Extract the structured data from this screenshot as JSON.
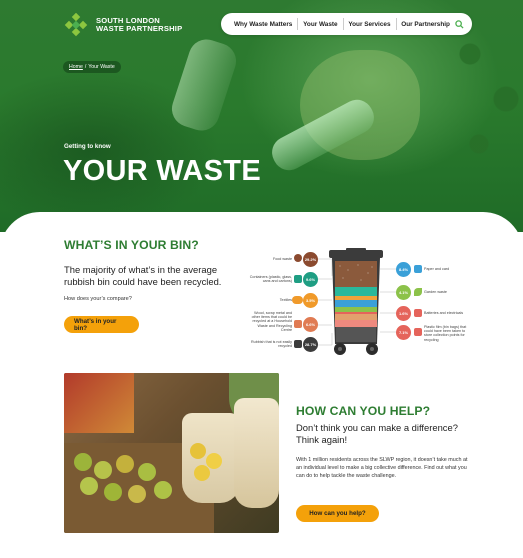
{
  "header": {
    "logo_line1": "SOUTH LONDON",
    "logo_line2": "WASTE PARTNERSHIP",
    "brand_color": "#2e7d32",
    "nav_items": [
      "Why Waste Matters",
      "Your Waste",
      "Your Services",
      "Our Partnership"
    ],
    "search_icon": "search-icon"
  },
  "breadcrumb": {
    "home": "Home",
    "separator": "/",
    "current": "Your Waste"
  },
  "hero": {
    "kicker": "Getting to know",
    "title": "YOUR WASTE"
  },
  "bin_section": {
    "title": "WHAT’S IN YOUR BIN?",
    "lead": "The majority of what’s in the average rubbish bin could have been recycled.",
    "question": "How does your’s compare?",
    "button": "What’s in your bin?",
    "accent": "#f4a10a",
    "infographic": {
      "left": [
        {
          "label": "Food waste",
          "pct": "29.2%",
          "color": "#8b4a2f"
        },
        {
          "label": "Containers (plastic, glass, cans and cartons)",
          "pct": "9.6%",
          "color": "#1f9e83"
        },
        {
          "label": "Textiles",
          "pct": "3.5%",
          "color": "#f09a2a"
        },
        {
          "label": "Wood, scrap metal and other items that could be recycled at a Household Waste and Recycling Centre",
          "pct": "6.6%",
          "color": "#e07b53"
        },
        {
          "label": "Rubbish that is not easily recycled",
          "pct": "28.7%",
          "color": "#3c3c3c"
        }
      ],
      "right": [
        {
          "label": "Paper and card",
          "pct": "8.4%",
          "color": "#3aa0d8"
        },
        {
          "label": "Garden waste",
          "pct": "4.1%",
          "color": "#8cc24a"
        },
        {
          "label": "Batteries and electricals",
          "pct": "1.6%",
          "color": "#e5645b"
        },
        {
          "label": "Plastic film (bin bags) that could have been taken to store collection points for recycling",
          "pct": "7.1%",
          "color": "#e5645b"
        }
      ]
    }
  },
  "help_section": {
    "title": "HOW CAN YOU HELP?",
    "lead": "Don’t think you can make a difference? Think again!",
    "body": "With 1 million residents across the SLWP region, it doesn’t take much at an individual level to make a big collective difference. Find out what you can do to help tackle the waste challenge.",
    "button": "How can you help?"
  }
}
